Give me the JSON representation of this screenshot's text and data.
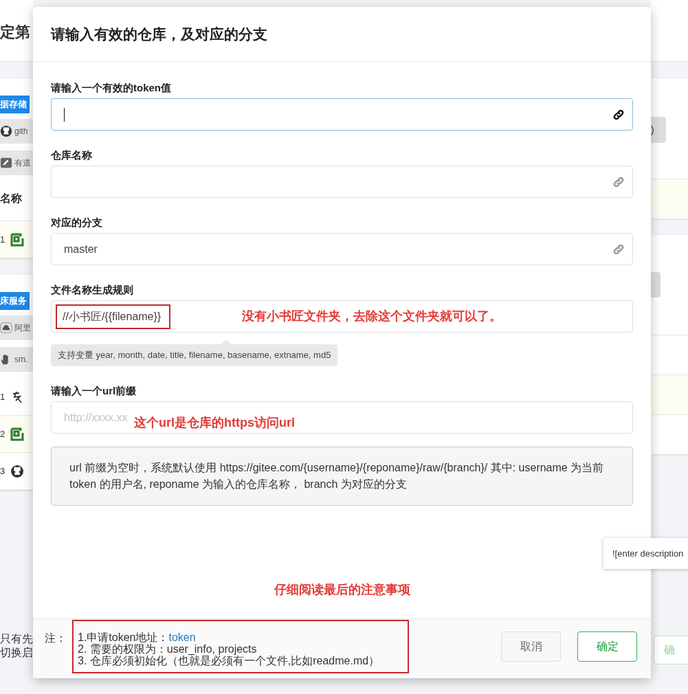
{
  "background_page": {
    "title": "定第",
    "cards": [
      {
        "tag": "据存储",
        "options": [
          {
            "kind": "github",
            "label": "gith"
          },
          {
            "kind": "pencil",
            "label": "有道"
          }
        ],
        "column_header": "名称",
        "rows": [
          {
            "index": "1",
            "kind": "square",
            "highlighted": true
          }
        ]
      },
      {
        "tag": "床服务",
        "options": [
          {
            "kind": "cloud",
            "label": "阿里"
          },
          {
            "kind": "hand",
            "label": "sm."
          }
        ],
        "rows": [
          {
            "index": "1",
            "kind": "glyph",
            "highlighted": false
          },
          {
            "index": "2",
            "kind": "square",
            "highlighted": true
          },
          {
            "index": "3",
            "kind": "github",
            "highlighted": false
          }
        ]
      }
    ],
    "right_pill": ")",
    "footer_lines": [
      "只有先",
      "切换启"
    ],
    "tooltip": "![enter description",
    "faded_button": "确"
  },
  "dialog": {
    "title": "请输入有效的仓库，及对应的分支",
    "fields": [
      {
        "label": "请输入一个有效的token值",
        "focused": true,
        "kind": "link"
      },
      {
        "label": "仓库名称",
        "focused": false,
        "kind": "link"
      },
      {
        "label": "对应的分支",
        "value": "master",
        "focused": false,
        "kind": "link"
      },
      {
        "label": "文件名称生成规则",
        "value": "//小书匠/{{filename}}",
        "focused": false,
        "boxed": true,
        "annotation": "没有小书匠文件夹，去除这个文件夹就可以了。",
        "hint": "支持变量 year, month, date, title, filename, basename, extname, md5"
      },
      {
        "label": "请输入一个url前缀",
        "placeholder": "http://xxxx.xx",
        "focused": false,
        "annotation": "这个url是仓库的https访问url"
      }
    ],
    "info": "url 前缀为空时，系统默认使用 https://gitee.com/{username}/{reponame}/raw/{branch}/ 其中: username 为当前 token 的用户名, reponame 为输入的仓库名称， branch 为对应的分支",
    "annotation": "仔细阅读最后的注意事项",
    "notes": {
      "label": "注：",
      "boxed": true,
      "lines": [
        {
          "text": "1.申请token地址：",
          "link": "token"
        },
        {
          "text": "2. 需要的权限为：user_info, projects"
        },
        {
          "text": "3. 仓库必须初始化（也就是必须有一个文件,比如readme.md）"
        }
      ]
    },
    "buttons": [
      {
        "label": "取消",
        "kind": "default"
      },
      {
        "label": "确定",
        "kind": "primary"
      }
    ]
  }
}
